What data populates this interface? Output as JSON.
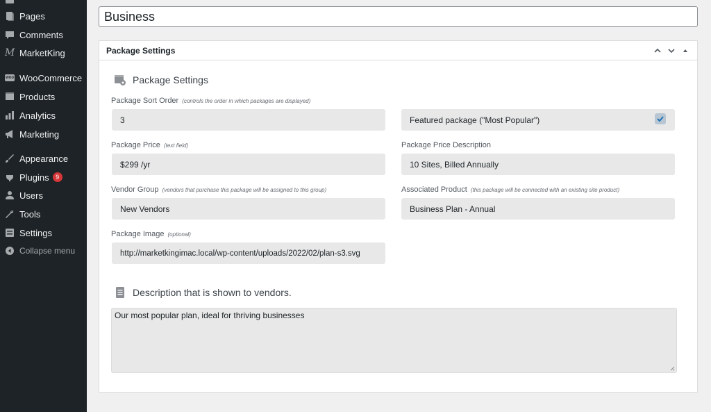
{
  "sidebar": {
    "items": [
      {
        "label": "Pages",
        "icon": "pages-icon"
      },
      {
        "label": "Comments",
        "icon": "comments-icon"
      },
      {
        "label": "MarketKing",
        "icon": "marketking-icon"
      },
      {
        "label": "WooCommerce",
        "icon": "woocommerce-icon"
      },
      {
        "label": "Products",
        "icon": "products-icon"
      },
      {
        "label": "Analytics",
        "icon": "analytics-icon"
      },
      {
        "label": "Marketing",
        "icon": "marketing-icon"
      },
      {
        "label": "Appearance",
        "icon": "appearance-icon"
      },
      {
        "label": "Plugins",
        "icon": "plugins-icon",
        "badge": "9"
      },
      {
        "label": "Users",
        "icon": "users-icon"
      },
      {
        "label": "Tools",
        "icon": "tools-icon"
      },
      {
        "label": "Settings",
        "icon": "settings-icon"
      },
      {
        "label": "Collapse menu",
        "icon": "collapse-icon"
      }
    ],
    "marketking_glyph": "M",
    "woo_glyph": "woo"
  },
  "title": {
    "value": "Business"
  },
  "postbox": {
    "title": "Package Settings",
    "section_title": "Package Settings",
    "fields": {
      "sort_order": {
        "label": "Package Sort Order",
        "hint": "(controls the order in which packages are displayed)",
        "value": "3"
      },
      "featured": {
        "label": "Featured package (\"Most Popular\")",
        "checked": true
      },
      "price": {
        "label": "Package Price",
        "hint": "(text field)",
        "value": "$299 /yr"
      },
      "price_description": {
        "label": "Package Price Description",
        "value": "10 Sites, Billed Annually"
      },
      "vendor_group": {
        "label": "Vendor Group",
        "hint": "(vendors that purchase this package will be assigned to this group)",
        "value": "New Vendors"
      },
      "associated_product": {
        "label": "Associated Product",
        "hint": "(this package will be connected with an existing site product)",
        "value": "Business Plan - Annual"
      },
      "image": {
        "label": "Package Image",
        "hint": "(optional)",
        "value": "http://marketkingimac.local/wp-content/uploads/2022/02/plan-s3.svg"
      }
    },
    "description_title": "Description that is shown to vendors.",
    "description_value": "Our most popular plan, ideal for thriving businesses"
  },
  "colors": {
    "sidebar_bg": "#1d2327",
    "badge": "#d63638",
    "field_bg": "#e8e8e8",
    "checkbox": "#b8c6d3"
  }
}
